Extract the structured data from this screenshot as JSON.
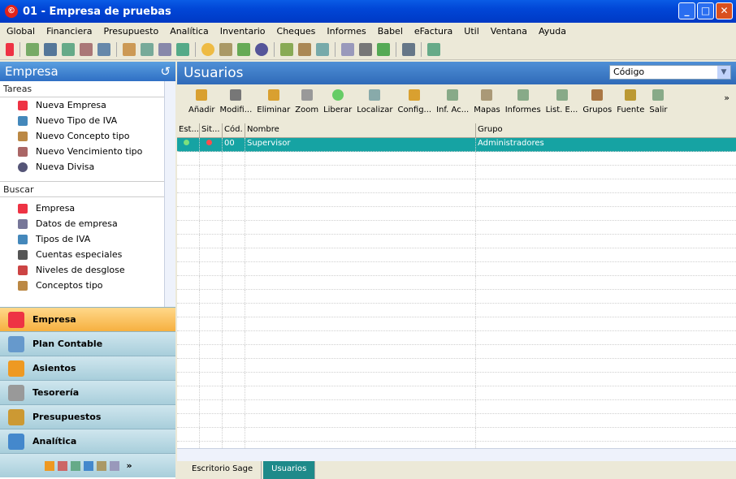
{
  "window": {
    "title": "01 - Empresa de pruebas",
    "app_icon": "©"
  },
  "menu": [
    "Global",
    "Financiera",
    "Presupuesto",
    "Analítica",
    "Inventario",
    "Cheques",
    "Informes",
    "Babel",
    "eFactura",
    "Util",
    "Ventana",
    "Ayuda"
  ],
  "left": {
    "title": "Empresa",
    "tareas_label": "Tareas",
    "tareas": [
      "Nueva Empresa",
      "Nuevo Tipo de IVA",
      "Nuevo Concepto tipo",
      "Nuevo Vencimiento tipo",
      "Nueva Divisa"
    ],
    "buscar_label": "Buscar",
    "buscar": [
      "Empresa",
      "Datos de empresa",
      "Tipos de IVA",
      "Cuentas especiales",
      "Niveles de desglose",
      "Conceptos tipo"
    ],
    "nav": [
      "Empresa",
      "Plan Contable",
      "Asientos",
      "Tesorería",
      "Presupuestos",
      "Analítica"
    ]
  },
  "main": {
    "title": "Usuarios",
    "search_field": "Código",
    "actions": [
      "Añadir",
      "Modifi...",
      "Eliminar",
      "Zoom",
      "Liberar",
      "Localizar",
      "Config...",
      "Inf. Ac...",
      "Mapas",
      "Informes",
      "List. E...",
      "Grupos",
      "Fuente",
      "Salir"
    ],
    "columns": [
      "Est...",
      "Sit...",
      "Cód.",
      "Nombre",
      "Grupo"
    ],
    "rows": [
      {
        "cod": "00",
        "nombre": "Supervisor",
        "grupo": "Administradores"
      }
    ],
    "tabs": [
      "Escritorio Sage",
      "Usuarios"
    ]
  },
  "colors": {
    "titlebar": "#0146d6",
    "selection": "#16a3a3",
    "nav_active": "#f6b040"
  }
}
